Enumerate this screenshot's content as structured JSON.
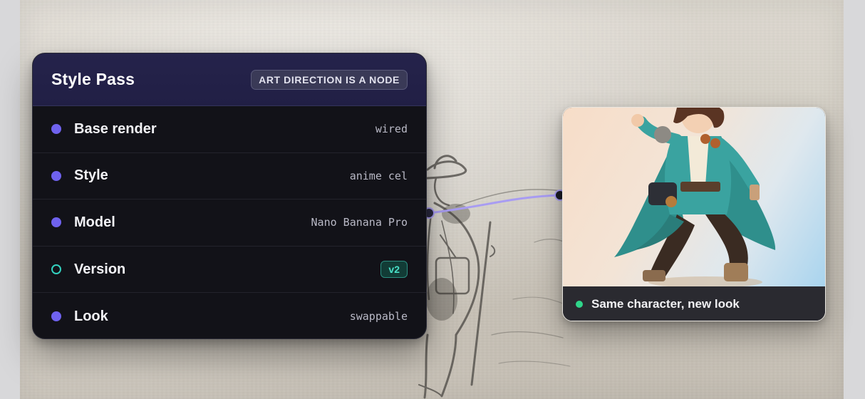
{
  "node": {
    "title": "Style Pass",
    "badge": "ART DIRECTION IS A NODE",
    "rows": [
      {
        "label": "Base render",
        "value": "wired",
        "port": "filled"
      },
      {
        "label": "Style",
        "value": "anime cel",
        "port": "filled"
      },
      {
        "label": "Model",
        "value": "Nano Banana Pro",
        "port": "filled"
      },
      {
        "label": "Version",
        "value": "v2",
        "port": "hollow"
      },
      {
        "label": "Look",
        "value": "swappable",
        "port": "filled"
      }
    ]
  },
  "output": {
    "caption": "Same character, new look",
    "status_color": "#2fd58a"
  },
  "colors": {
    "port": "#6f62ee",
    "port_hollow": "#33d1bf",
    "header": "#25234b",
    "connector": "#a89cf2"
  }
}
